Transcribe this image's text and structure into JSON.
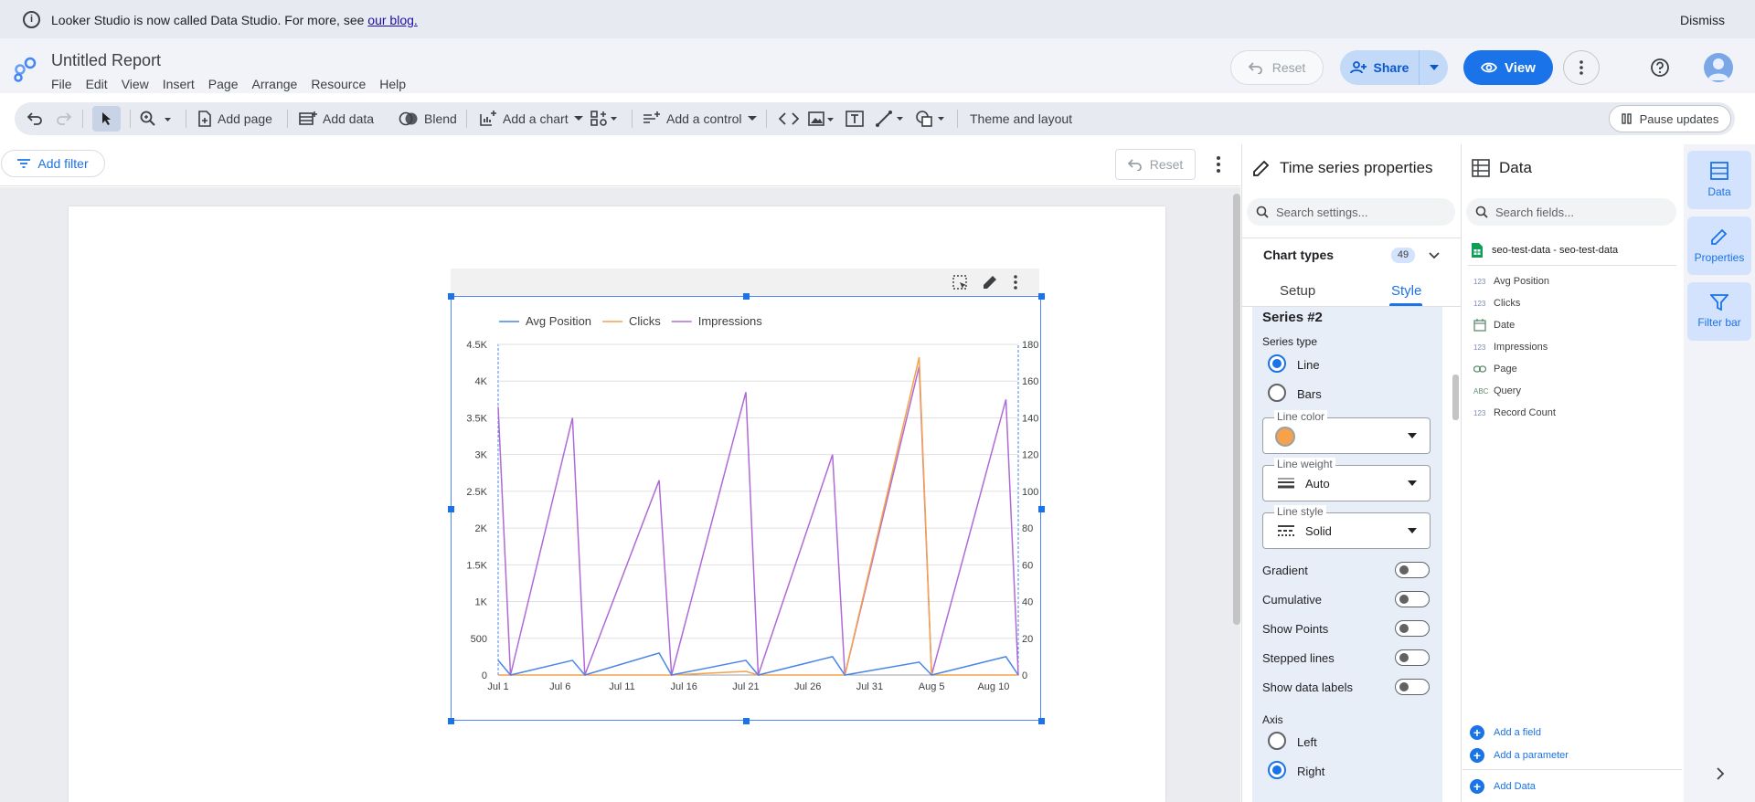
{
  "banner": {
    "message": "Looker Studio is now called Data Studio. For more, see ",
    "link": "our blog.",
    "dismiss": "Dismiss"
  },
  "header": {
    "title": "Untitled Report",
    "menus": [
      "File",
      "Edit",
      "View",
      "Insert",
      "Page",
      "Arrange",
      "Resource",
      "Help"
    ],
    "reset": "Reset",
    "share": "Share",
    "view": "View"
  },
  "toolbar": {
    "add_page": "Add page",
    "add_data": "Add data",
    "blend": "Blend",
    "add_chart": "Add a chart",
    "add_control": "Add a control",
    "theme_layout": "Theme and layout",
    "pause_updates": "Pause updates"
  },
  "filterbar": {
    "add_filter": "Add filter",
    "reset": "Reset"
  },
  "chart_data": {
    "type": "line",
    "legend": [
      "Avg Position",
      "Clicks",
      "Impressions"
    ],
    "legend_position": "top-left",
    "left_axis_ticks": [
      "0",
      "500",
      "1K",
      "1.5K",
      "2K",
      "2.5K",
      "3K",
      "3.5K",
      "4K",
      "4.5K"
    ],
    "right_axis_ticks": [
      "0",
      "20",
      "40",
      "60",
      "80",
      "100",
      "120",
      "140",
      "160",
      "180"
    ],
    "x_ticks": [
      "Jul 1",
      "Jul 6",
      "Jul 11",
      "Jul 16",
      "Jul 21",
      "Jul 26",
      "Jul 31",
      "Aug 5",
      "Aug 10"
    ],
    "left_ylim": [
      0,
      4500
    ],
    "right_ylim": [
      0,
      180
    ],
    "x": [
      "Jul 1",
      "Jul 2",
      "Jul 7",
      "Jul 8",
      "Jul 14",
      "Jul 15",
      "Jul 21",
      "Jul 22",
      "Jul 28",
      "Jul 29",
      "Aug 4",
      "Aug 5",
      "Aug 11",
      "Aug 12"
    ],
    "series": [
      {
        "name": "Impressions",
        "axis": "left",
        "color": "#b06ad6",
        "values": [
          3650,
          0,
          3500,
          0,
          2650,
          0,
          3850,
          0,
          3000,
          0,
          4200,
          0,
          3750,
          0
        ]
      },
      {
        "name": "Clicks",
        "axis": "right",
        "color": "#f4a24b",
        "values": [
          0,
          0,
          0,
          0,
          0,
          0,
          2,
          0,
          0,
          0,
          173,
          0,
          0,
          0
        ]
      },
      {
        "name": "Avg Position",
        "axis": "right",
        "color": "#4a86e8",
        "values": [
          8,
          0,
          8,
          0,
          12,
          0,
          8,
          0,
          10,
          0,
          7,
          0,
          10,
          0
        ]
      }
    ],
    "grid": true
  },
  "properties": {
    "title": "Time series properties",
    "search_placeholder": "Search settings...",
    "chart_types": "Chart types",
    "chart_types_count": "49",
    "tab_setup": "Setup",
    "tab_style": "Style",
    "series_title": "Series #2",
    "series_type": "Series type",
    "opt_line": "Line",
    "opt_bars": "Bars",
    "line_color_label": "Line color",
    "line_color": "#f4a24b",
    "line_weight_label": "Line weight",
    "line_weight": "Auto",
    "line_style_label": "Line style",
    "line_style": "Solid",
    "toggles": [
      "Gradient",
      "Cumulative",
      "Show Points",
      "Stepped lines",
      "Show data labels"
    ],
    "axis_label": "Axis",
    "axis_left": "Left",
    "axis_right": "Right"
  },
  "data_panel": {
    "title": "Data",
    "search_placeholder": "Search fields...",
    "source": "seo-test-data - seo-test-data",
    "fields": [
      {
        "type": "123",
        "name": "Avg Position"
      },
      {
        "type": "123",
        "name": "Clicks"
      },
      {
        "type": "date",
        "name": "Date"
      },
      {
        "type": "123",
        "name": "Impressions"
      },
      {
        "type": "link",
        "name": "Page"
      },
      {
        "type": "ABC",
        "name": "Query"
      },
      {
        "type": "123",
        "name": "Record Count"
      }
    ],
    "add_field": "Add a field",
    "add_parameter": "Add a parameter",
    "add_data": "Add Data"
  },
  "rail": {
    "data": "Data",
    "properties": "Properties",
    "filter_bar": "Filter bar"
  }
}
